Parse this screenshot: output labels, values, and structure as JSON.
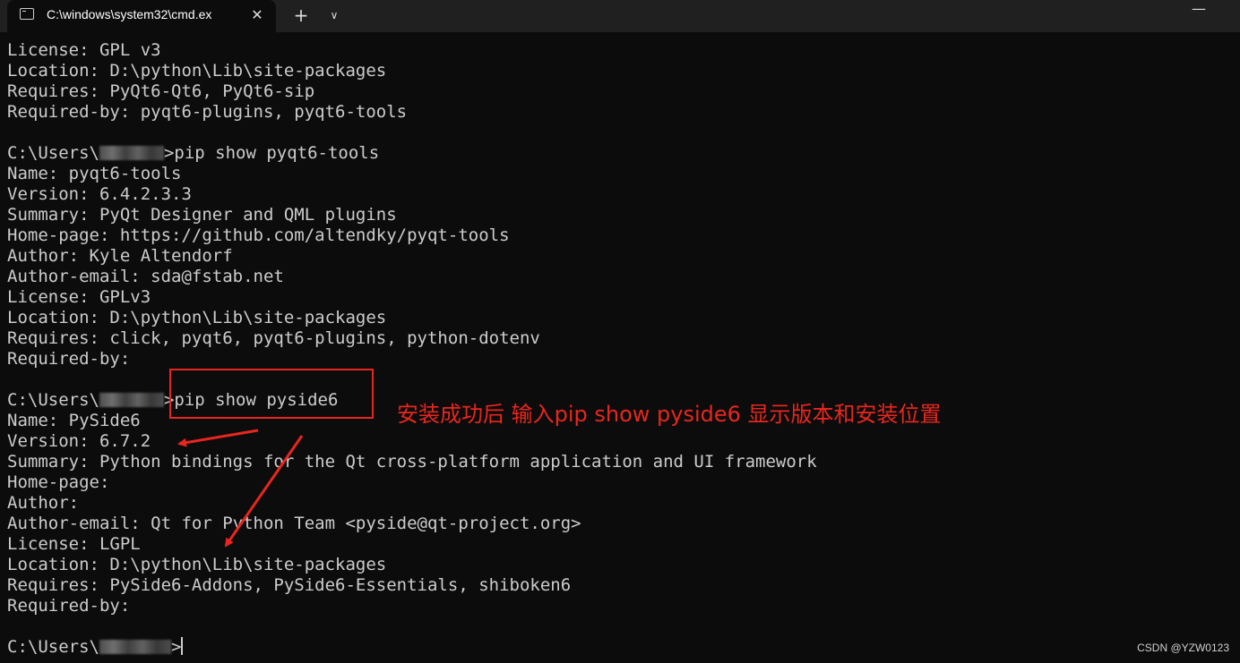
{
  "window": {
    "tab_title": "C:\\windows\\system32\\cmd.ex",
    "tab_close_glyph": "✕",
    "new_tab_glyph": "+",
    "dropdown_glyph": "∨",
    "minimize_glyph": "—"
  },
  "terminal": {
    "text_color": "#cccccc",
    "background": "#0c0c0c",
    "prompt_prefix": "C:\\Users\\",
    "block1": {
      "license": "License: GPL v3",
      "location": "Location: D:\\python\\Lib\\site-packages",
      "requires": "Requires: PyQt6-Qt6, PyQt6-sip",
      "required_by": "Required-by: pyqt6-plugins, pyqt6-tools"
    },
    "cmd2": ">pip show pyqt6-tools",
    "block2": {
      "name": "Name: pyqt6-tools",
      "version": "Version: 6.4.2.3.3",
      "summary": "Summary: PyQt Designer and QML plugins",
      "home_page": "Home-page: https://github.com/altendky/pyqt-tools",
      "author": "Author: Kyle Altendorf",
      "author_email": "Author-email: sda@fstab.net",
      "license": "License: GPLv3",
      "location": "Location: D:\\python\\Lib\\site-packages",
      "requires": "Requires: click, pyqt6, pyqt6-plugins, python-dotenv",
      "required_by": "Required-by:"
    },
    "cmd3": ">pip show pyside6",
    "block3": {
      "name": "Name: PySide6",
      "version": "Version: 6.7.2",
      "summary": "Summary: Python bindings for the Qt cross-platform application and UI framework",
      "home_page": "Home-page:",
      "author": "Author:",
      "author_email": "Author-email: Qt for Python Team <pyside@qt-project.org>",
      "license": "License: LGPL",
      "location": "Location: D:\\python\\Lib\\site-packages",
      "requires": "Requires: PySide6-Addons, PySide6-Essentials, shiboken6",
      "required_by": "Required-by:"
    },
    "final_prompt_suffix": ">"
  },
  "annotation": {
    "text": "安装成功后 输入pip show pyside6 显示版本和安装位置",
    "color": "#e8261f"
  },
  "watermark": "CSDN @YZW0123"
}
